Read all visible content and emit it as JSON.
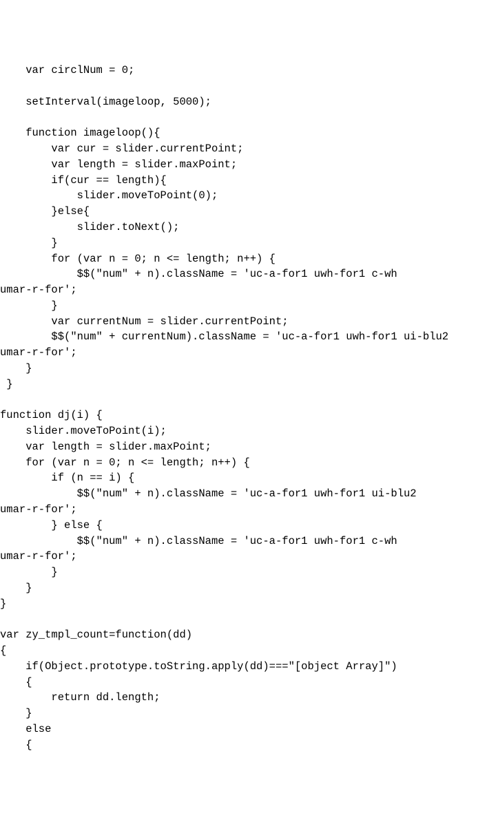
{
  "code": {
    "lines": [
      "    var circlNum = 0;",
      "",
      "    setInterval(imageloop, 5000);",
      "",
      "    function imageloop(){",
      "        var cur = slider.currentPoint;",
      "        var length = slider.maxPoint;",
      "        if(cur == length){",
      "            slider.moveToPoint(0);",
      "        }else{",
      "            slider.toNext();",
      "        }",
      "        for (var n = 0; n <= length; n++) {",
      "            $$(\"num\" + n).className = 'uc-a-for1 uwh-for1 c-wh",
      "umar-r-for';",
      "        }",
      "        var currentNum = slider.currentPoint;",
      "        $$(\"num\" + currentNum).className = 'uc-a-for1 uwh-for1 ui-blu2",
      "umar-r-for';",
      "    }",
      " }",
      "",
      "function dj(i) {",
      "    slider.moveToPoint(i);",
      "    var length = slider.maxPoint;",
      "    for (var n = 0; n <= length; n++) {",
      "        if (n == i) {",
      "            $$(\"num\" + n).className = 'uc-a-for1 uwh-for1 ui-blu2",
      "umar-r-for';",
      "        } else {",
      "            $$(\"num\" + n).className = 'uc-a-for1 uwh-for1 c-wh",
      "umar-r-for';",
      "        }",
      "    }",
      "}",
      "",
      "var zy_tmpl_count=function(dd)",
      "{",
      "    if(Object.prototype.toString.apply(dd)===\"[object Array]\")",
      "    {",
      "        return dd.length;",
      "    }",
      "    else",
      "    {"
    ]
  }
}
